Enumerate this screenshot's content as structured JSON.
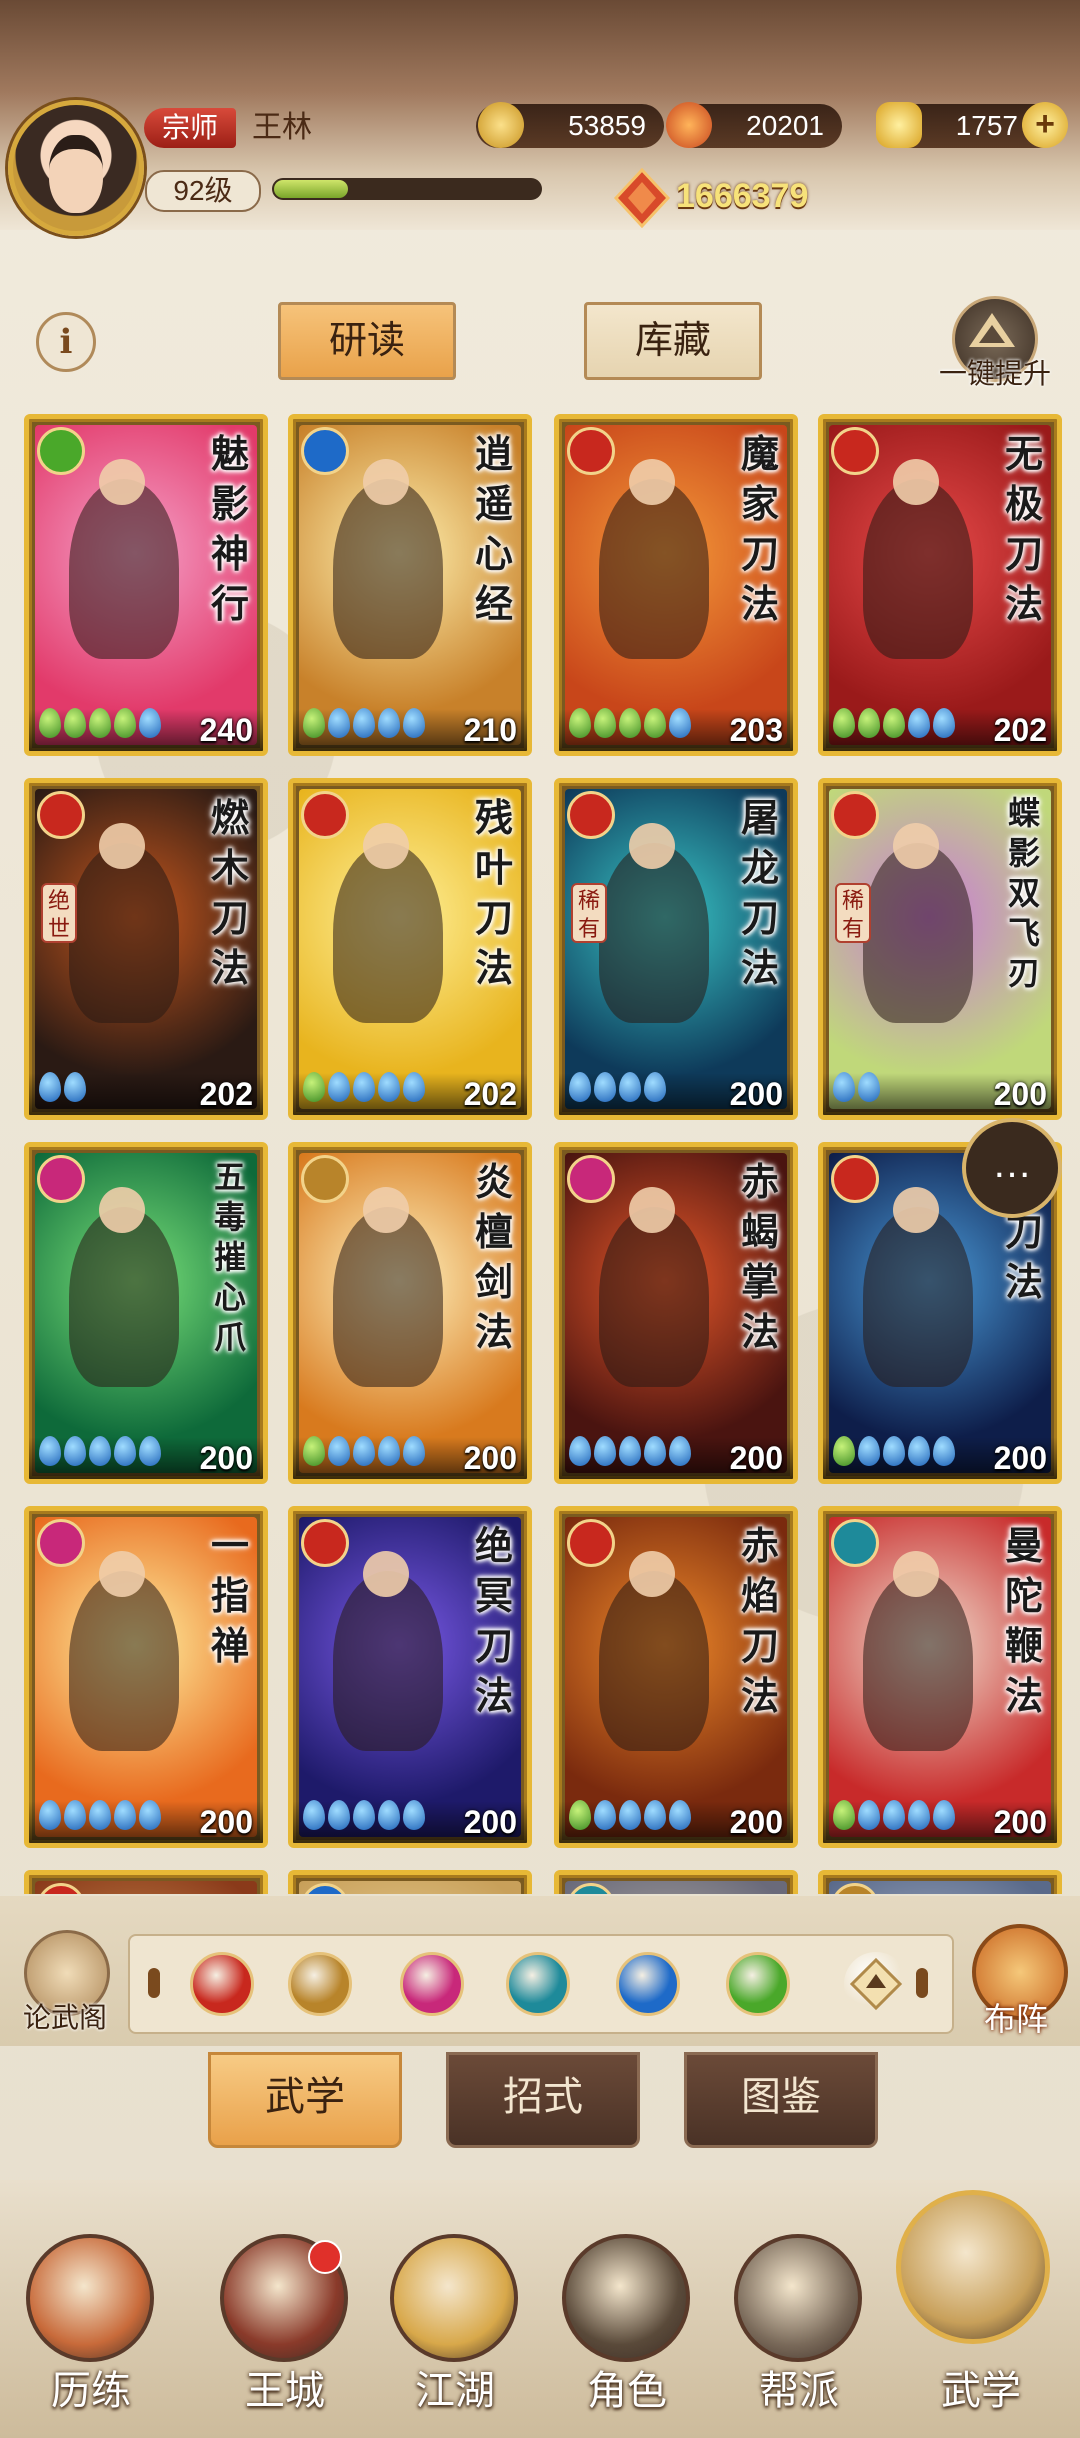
{
  "header": {
    "rank_badge": "宗师",
    "player_name": "王林",
    "level": "92级",
    "exp_progress": 0.28,
    "resources": [
      {
        "icon": "coin-icon",
        "value": "53859",
        "color": "#e8b43a"
      },
      {
        "icon": "flame-icon",
        "value": "20201",
        "color": "#e86a2a"
      },
      {
        "icon": "gold-ingot-icon",
        "value": "1757",
        "color": "#f2c23a"
      }
    ],
    "combat_power": "1666379"
  },
  "tabs": {
    "study": "研读",
    "storage": "库藏"
  },
  "upgrade_label": "一键提升",
  "cards": [
    {
      "name": "魅影神行",
      "school": "green",
      "pips": [
        "g",
        "g",
        "g",
        "g",
        "b"
      ],
      "score": "240",
      "colors": [
        "#e23a6a",
        "#f5a0c8"
      ]
    },
    {
      "name": "逍遥心经",
      "school": "blue",
      "pips": [
        "g",
        "b",
        "b",
        "b",
        "b"
      ],
      "score": "210",
      "colors": [
        "#c8812a",
        "#fff1b0"
      ]
    },
    {
      "name": "魔家刀法",
      "school": "red",
      "pips": [
        "g",
        "g",
        "g",
        "g",
        "b"
      ],
      "score": "203",
      "colors": [
        "#c8461a",
        "#f59a3a"
      ]
    },
    {
      "name": "无极刀法",
      "school": "red",
      "pips": [
        "g",
        "g",
        "g",
        "b",
        "b"
      ],
      "score": "202",
      "colors": [
        "#9a1a1a",
        "#e84a4a"
      ]
    },
    {
      "name": "燃木刀法",
      "school": "red",
      "pips": [
        "b",
        "b"
      ],
      "score": "202",
      "colors": [
        "#2a1a14",
        "#c8581e"
      ],
      "tag": "绝世"
    },
    {
      "name": "残叶刀法",
      "school": "red",
      "pips": [
        "g",
        "b",
        "b",
        "b",
        "b"
      ],
      "score": "202",
      "colors": [
        "#e8b41e",
        "#fff19a"
      ]
    },
    {
      "name": "屠龙刀法",
      "school": "red",
      "pips": [
        "b",
        "b",
        "b",
        "b"
      ],
      "score": "200",
      "colors": [
        "#0e3a5a",
        "#3ac8c8"
      ],
      "tag": "稀有"
    },
    {
      "name": "蝶影双飞刃",
      "school": "red",
      "pips": [
        "b",
        "b"
      ],
      "score": "200",
      "colors": [
        "#c0d87a",
        "#c87ad8"
      ],
      "tag": "稀有"
    },
    {
      "name": "五毒摧心爪",
      "school": "pink",
      "pips": [
        "b",
        "b",
        "b",
        "b",
        "b"
      ],
      "score": "200",
      "colors": [
        "#0e6a3a",
        "#7ae27a"
      ]
    },
    {
      "name": "炎檀剑法",
      "school": "gold",
      "pips": [
        "g",
        "b",
        "b",
        "b",
        "b"
      ],
      "score": "200",
      "colors": [
        "#d87a1e",
        "#fff3c0"
      ]
    },
    {
      "name": "赤蝎掌法",
      "school": "pink",
      "pips": [
        "b",
        "b",
        "b",
        "b",
        "b"
      ],
      "score": "200",
      "colors": [
        "#4a1410",
        "#e8582a"
      ]
    },
    {
      "name": "月刀法",
      "school": "red",
      "pips": [
        "g",
        "b",
        "b",
        "b",
        "b"
      ],
      "score": "200",
      "colors": [
        "#0e1e4a",
        "#4a9ad8"
      ]
    },
    {
      "name": "一指禅",
      "school": "pink",
      "pips": [
        "b",
        "b",
        "b",
        "b",
        "b"
      ],
      "score": "200",
      "colors": [
        "#e86a1e",
        "#fff0a0"
      ]
    },
    {
      "name": "绝冥刀法",
      "school": "red",
      "pips": [
        "b",
        "b",
        "b",
        "b",
        "b"
      ],
      "score": "200",
      "colors": [
        "#1e1a6a",
        "#7a5ae8"
      ]
    },
    {
      "name": "赤焰刀法",
      "school": "red",
      "pips": [
        "g",
        "b",
        "b",
        "b",
        "b"
      ],
      "score": "200",
      "colors": [
        "#7a2a0e",
        "#f08a2a"
      ]
    },
    {
      "name": "曼陀鞭法",
      "school": "teal",
      "pips": [
        "g",
        "b",
        "b",
        "b",
        "b"
      ],
      "score": "200",
      "colors": [
        "#c82a2a",
        "#f0e0d0"
      ]
    },
    {
      "name": "",
      "school": "red",
      "pips": [],
      "score": "",
      "colors": [
        "#8a3a1a",
        "#d8a05a"
      ]
    },
    {
      "name": "",
      "school": "blue",
      "pips": [],
      "score": "",
      "colors": [
        "#c8a05a",
        "#f0d8a0"
      ]
    },
    {
      "name": "",
      "school": "teal",
      "pips": [],
      "score": "",
      "colors": [
        "#6a6a7a",
        "#c8c0b0"
      ]
    },
    {
      "name": "",
      "school": "gold",
      "pips": [],
      "score": "",
      "colors": [
        "#5a6a8a",
        "#c0c8d8"
      ]
    }
  ],
  "school_colors": {
    "green": "#4aa82a",
    "blue": "#1e6ac8",
    "red": "#c8281e",
    "pink": "#c8287a",
    "gold": "#b8842a",
    "teal": "#1e8a9a"
  },
  "chat_icon": "chat-bubble-icon",
  "lunwu_label": "论武阁",
  "filters": [
    {
      "icon": "blade-school-icon",
      "color": "#c8281e"
    },
    {
      "icon": "sword-school-icon",
      "color": "#b8842a"
    },
    {
      "icon": "palm-school-icon",
      "color": "#c8287a"
    },
    {
      "icon": "fan-school-icon",
      "color": "#1e8a9a"
    },
    {
      "icon": "yin-yang-school-icon",
      "color": "#1e6ac8"
    },
    {
      "icon": "movement-school-icon",
      "color": "#4aa82a"
    },
    {
      "icon": "all-school-icon",
      "color": "#efe5d0"
    }
  ],
  "buzhen_label": "布阵",
  "subtabs": [
    "武学",
    "招式",
    "图鉴"
  ],
  "nav": [
    {
      "label": "历练",
      "color": "#c86a3a"
    },
    {
      "label": "王城",
      "color": "#8a3a2a",
      "badge": true
    },
    {
      "label": "江湖",
      "color": "#d8a84a"
    },
    {
      "label": "角色",
      "color": "#5a4a3a"
    },
    {
      "label": "帮派",
      "color": "#7a6a5a"
    },
    {
      "label": "武学",
      "color": "#c8a05a",
      "active": true
    }
  ]
}
